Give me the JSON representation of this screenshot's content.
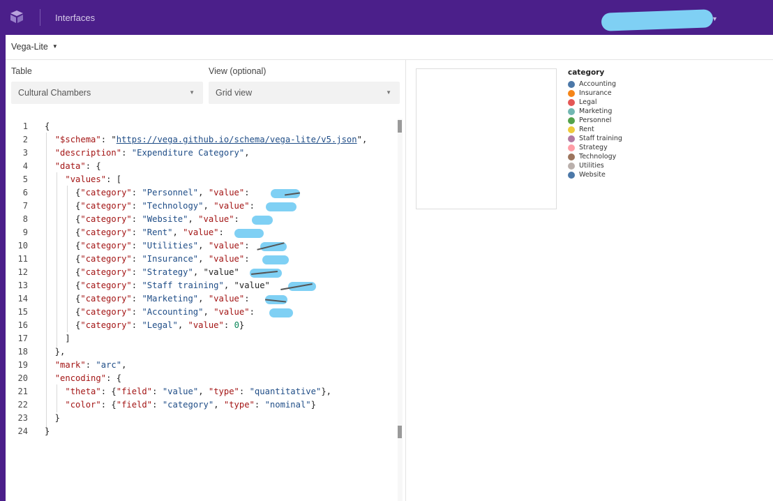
{
  "app": {
    "title": "Interfaces"
  },
  "extension": {
    "selector_label": "Vega-Lite"
  },
  "config": {
    "table_label": "Table",
    "table_value": "Cultural Chambers",
    "view_label": "View (optional)",
    "view_value": "Grid view"
  },
  "editor": {
    "line_numbers": [
      "1",
      "2",
      "3",
      "4",
      "5",
      "6",
      "7",
      "8",
      "9",
      "10",
      "11",
      "12",
      "13",
      "14",
      "15",
      "16",
      "17",
      "18",
      "19",
      "20",
      "21",
      "22",
      "23",
      "24"
    ],
    "lines": [
      "{",
      "  \"$schema\": \"https://vega.github.io/schema/vega-lite/v5.json\",",
      "  \"description\": \"Expenditure Category\",",
      "  \"data\": {",
      "    \"values\": [",
      "      {\"category\": \"Personnel\", \"value\": ",
      "      {\"category\": \"Technology\", \"value\":",
      "      {\"category\": \"Website\", \"value\": ",
      "      {\"category\": \"Rent\", \"value\":",
      "      {\"category\": \"Utilities\", \"value\":",
      "      {\"category\": \"Insurance\", \"value\":",
      "      {\"category\": \"Strategy\", \"value\"",
      "      {\"category\": \"Staff training\", \"value\"",
      "      {\"category\": \"Marketing\", \"value\":",
      "      {\"category\": \"Accounting\", \"value\":",
      "      {\"category\": \"Legal\", \"value\": 0}",
      "    ]",
      "  },",
      "  \"mark\": \"arc\",",
      "  \"encoding\": {",
      "    \"theta\": {\"field\": \"value\", \"type\": \"quantitative\"},",
      "    \"color\": {\"field\": \"category\", \"type\": \"nominal\"}",
      "  }",
      "}"
    ]
  },
  "legend": {
    "title": "category",
    "items": [
      {
        "label": "Accounting",
        "color": "#4c78a8"
      },
      {
        "label": "Insurance",
        "color": "#f58518"
      },
      {
        "label": "Legal",
        "color": "#e45756"
      },
      {
        "label": "Marketing",
        "color": "#72b7b2"
      },
      {
        "label": "Personnel",
        "color": "#54a24b"
      },
      {
        "label": "Rent",
        "color": "#eeca3b"
      },
      {
        "label": "Staff training",
        "color": "#b279a2"
      },
      {
        "label": "Strategy",
        "color": "#ff9da6"
      },
      {
        "label": "Technology",
        "color": "#9d755d"
      },
      {
        "label": "Utilities",
        "color": "#bab0ac"
      },
      {
        "label": "Website",
        "color": "#4c78a8"
      }
    ]
  }
}
